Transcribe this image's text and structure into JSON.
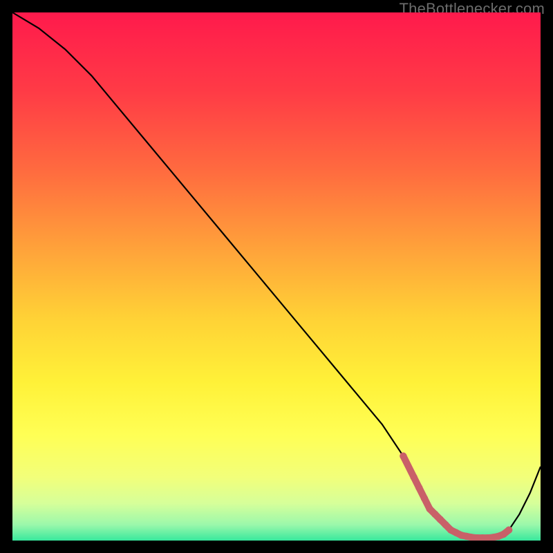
{
  "watermark": "TheBottlenecker.com",
  "colors": {
    "stroke": "#000000",
    "marker": "#c96068",
    "gradient_stops": [
      {
        "offset": 0.0,
        "color": "#ff1a4c"
      },
      {
        "offset": 0.15,
        "color": "#ff3b46"
      },
      {
        "offset": 0.3,
        "color": "#ff6b3f"
      },
      {
        "offset": 0.45,
        "color": "#ffa33a"
      },
      {
        "offset": 0.58,
        "color": "#ffd236"
      },
      {
        "offset": 0.7,
        "color": "#fff138"
      },
      {
        "offset": 0.8,
        "color": "#ffff55"
      },
      {
        "offset": 0.88,
        "color": "#f2ff7a"
      },
      {
        "offset": 0.93,
        "color": "#d6ff9a"
      },
      {
        "offset": 0.97,
        "color": "#9bf8ab"
      },
      {
        "offset": 1.0,
        "color": "#38e89d"
      }
    ]
  },
  "chart_data": {
    "type": "line",
    "title": "",
    "xlabel": "",
    "ylabel": "",
    "xlim": [
      0,
      100
    ],
    "ylim": [
      0,
      100
    ],
    "x": [
      0,
      5,
      10,
      15,
      20,
      25,
      30,
      35,
      40,
      45,
      50,
      55,
      60,
      65,
      70,
      74,
      76,
      78,
      80,
      82,
      84,
      86,
      88,
      90,
      92,
      94,
      96,
      98,
      100
    ],
    "values": [
      100,
      97,
      93,
      88,
      82,
      76,
      70,
      64,
      58,
      52,
      46,
      40,
      34,
      28,
      22,
      16,
      12,
      8,
      5,
      3,
      1.5,
      0.8,
      0.5,
      0.5,
      0.8,
      2,
      5,
      9,
      14
    ],
    "markers": {
      "x": [
        74,
        76,
        77,
        78,
        79,
        80,
        81,
        82,
        83,
        84,
        85,
        86,
        87,
        88,
        89,
        90,
        91,
        92,
        93,
        94
      ],
      "values": [
        16,
        12,
        10,
        8,
        6,
        5,
        4,
        3,
        2,
        1.5,
        1,
        0.8,
        0.6,
        0.5,
        0.5,
        0.5,
        0.6,
        0.8,
        1.2,
        2
      ]
    }
  }
}
